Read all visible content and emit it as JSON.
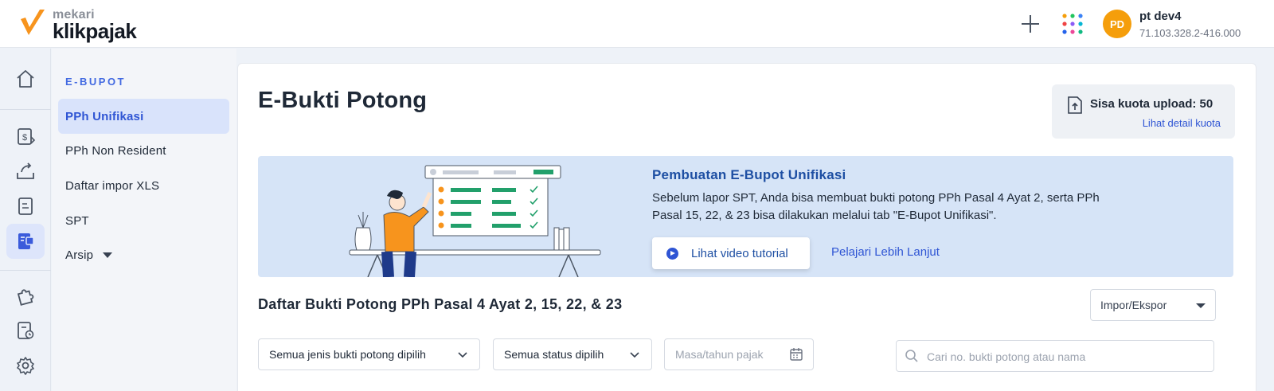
{
  "brand": {
    "top": "mekari",
    "main": "klikpajak",
    "accent_color": "#f7941d"
  },
  "header": {
    "add_icon": "plus-icon",
    "apps_icon": "apps-grid-icon",
    "user": {
      "initials": "PD",
      "name": "pt dev4",
      "npwp": "71.103.328.2-416.000"
    }
  },
  "rail": {
    "icons": [
      "home-icon",
      "tax-document-icon",
      "upload-tray-icon",
      "report-document-icon",
      "ebupot-icon",
      "puzzle-icon",
      "document-settings-icon",
      "settings-icon"
    ],
    "active": "ebupot-icon"
  },
  "sidemenu": {
    "heading": "E-BUPOT",
    "items": [
      {
        "label": "PPh Unifikasi",
        "active": true
      },
      {
        "label": "PPh Non Resident",
        "active": false
      },
      {
        "label": "Daftar impor XLS",
        "active": false
      },
      {
        "label": "SPT",
        "active": false
      },
      {
        "label": "Arsip",
        "active": false
      }
    ]
  },
  "main": {
    "title": "E-Bukti Potong",
    "quota": {
      "text": "Sisa kuota upload: 50",
      "link": "Lihat detail kuota"
    },
    "banner": {
      "title": "Pembuatan E-Bupot Unifikasi",
      "description": "Sebelum lapor SPT, Anda bisa membuat bukti potong PPh Pasal 4 Ayat 2, serta PPh Pasal 15, 22, & 23 bisa dilakukan melalui tab \"E-Bupot Unifikasi\".",
      "video_button": "Lihat video tutorial",
      "learn_link": "Pelajari Lebih Lanjut"
    },
    "list": {
      "title": "Daftar Bukti Potong PPh Pasal 4 Ayat 2, 15, 22, & 23",
      "impor_ekspor": "Impor/Ekspor",
      "filters": {
        "jenis": "Semua jenis bukti potong dipilih",
        "status": "Semua status dipilih",
        "masa_placeholder": "Masa/tahun pajak"
      },
      "search_placeholder": "Cari no. bukti potong atau nama"
    }
  }
}
